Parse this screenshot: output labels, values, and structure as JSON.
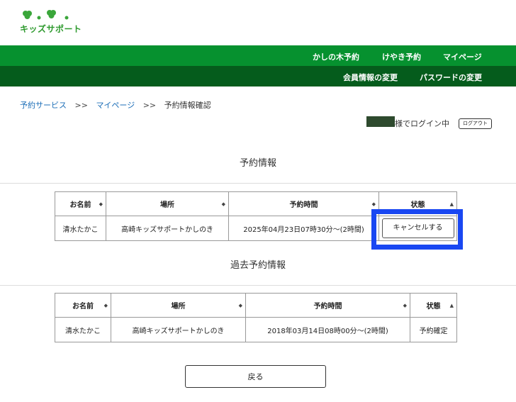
{
  "header": {
    "logo_text": "キッズサポート"
  },
  "nav_primary": [
    "かしの木予約",
    "けやき予約",
    "マイページ"
  ],
  "nav_secondary": [
    "会員情報の変更",
    "パスワードの変更"
  ],
  "breadcrumb": {
    "items": [
      "予約サービス",
      "マイページ",
      "予約情報確認"
    ],
    "separator": ">>"
  },
  "login": {
    "status": "様でログイン中",
    "logout_label": "ログアウト"
  },
  "current_reservations": {
    "title": "予約情報",
    "headers": [
      "お名前",
      "場所",
      "予約時間",
      "状態"
    ],
    "rows": [
      {
        "name": "清水たかこ",
        "place": "高崎キッズサポートかしのき",
        "time": "2025年04月23日07時30分〜(2時間)",
        "action_label": "キャンセルする"
      }
    ]
  },
  "past_reservations": {
    "title": "過去予約情報",
    "headers": [
      "お名前",
      "場所",
      "予約時間",
      "状態"
    ],
    "rows": [
      {
        "name": "清水たかこ",
        "place": "高崎キッズサポートかしのき",
        "time": "2018年03月14日08時00分〜(2時間)",
        "status": "予約確定"
      }
    ]
  },
  "back_label": "戻る",
  "colors": {
    "nav_primary_bg": "#06912f",
    "nav_secondary_bg": "#055c1c",
    "link": "#1d6fb8",
    "highlight": "#1947f2"
  },
  "icons": {
    "sort_both": "◆",
    "sort_up": "▲"
  }
}
